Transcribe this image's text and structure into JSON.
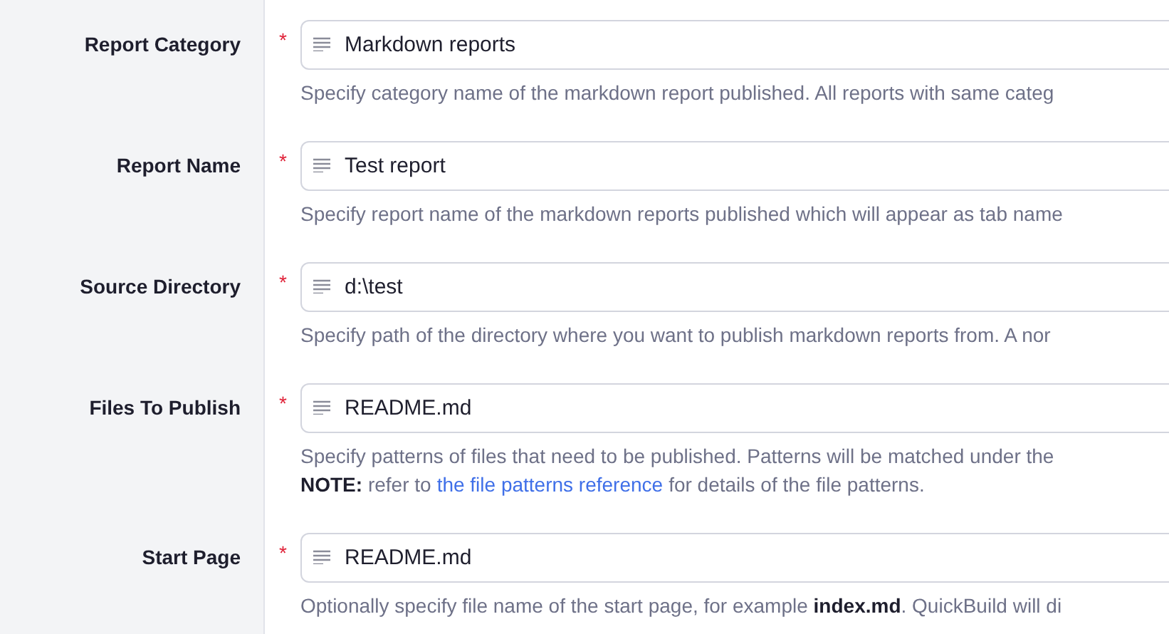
{
  "fields": [
    {
      "label": "Report Category",
      "required": true,
      "required_mark": "*",
      "value": "Markdown reports",
      "help": [
        {
          "text": "Specify category name of the markdown report published. All reports with same categ"
        }
      ]
    },
    {
      "label": "Report Name",
      "required": true,
      "required_mark": "*",
      "value": "Test report",
      "help": [
        {
          "text": "Specify report name of the markdown reports published which will appear as tab name"
        }
      ]
    },
    {
      "label": "Source Directory",
      "required": true,
      "required_mark": "*",
      "value": "d:\\test",
      "help": [
        {
          "text": "Specify path of the directory where you want to publish markdown reports from. A nor"
        }
      ]
    },
    {
      "label": "Files To Publish",
      "required": true,
      "required_mark": "*",
      "value": "README.md",
      "help": [
        {
          "text": "Specify patterns of files that need to be published. Patterns will be matched under the"
        },
        {
          "text": "**NOTE:** refer to",
          "link": "the file patterns reference",
          "after": "for details of the file patterns."
        }
      ]
    },
    {
      "label": "Start Page",
      "required": true,
      "required_mark": "*",
      "value": "README.md",
      "help": [
        {
          "text": "Optionally specify file name of the start page, for example **index.md**. QuickBuild will di"
        }
      ]
    }
  ]
}
